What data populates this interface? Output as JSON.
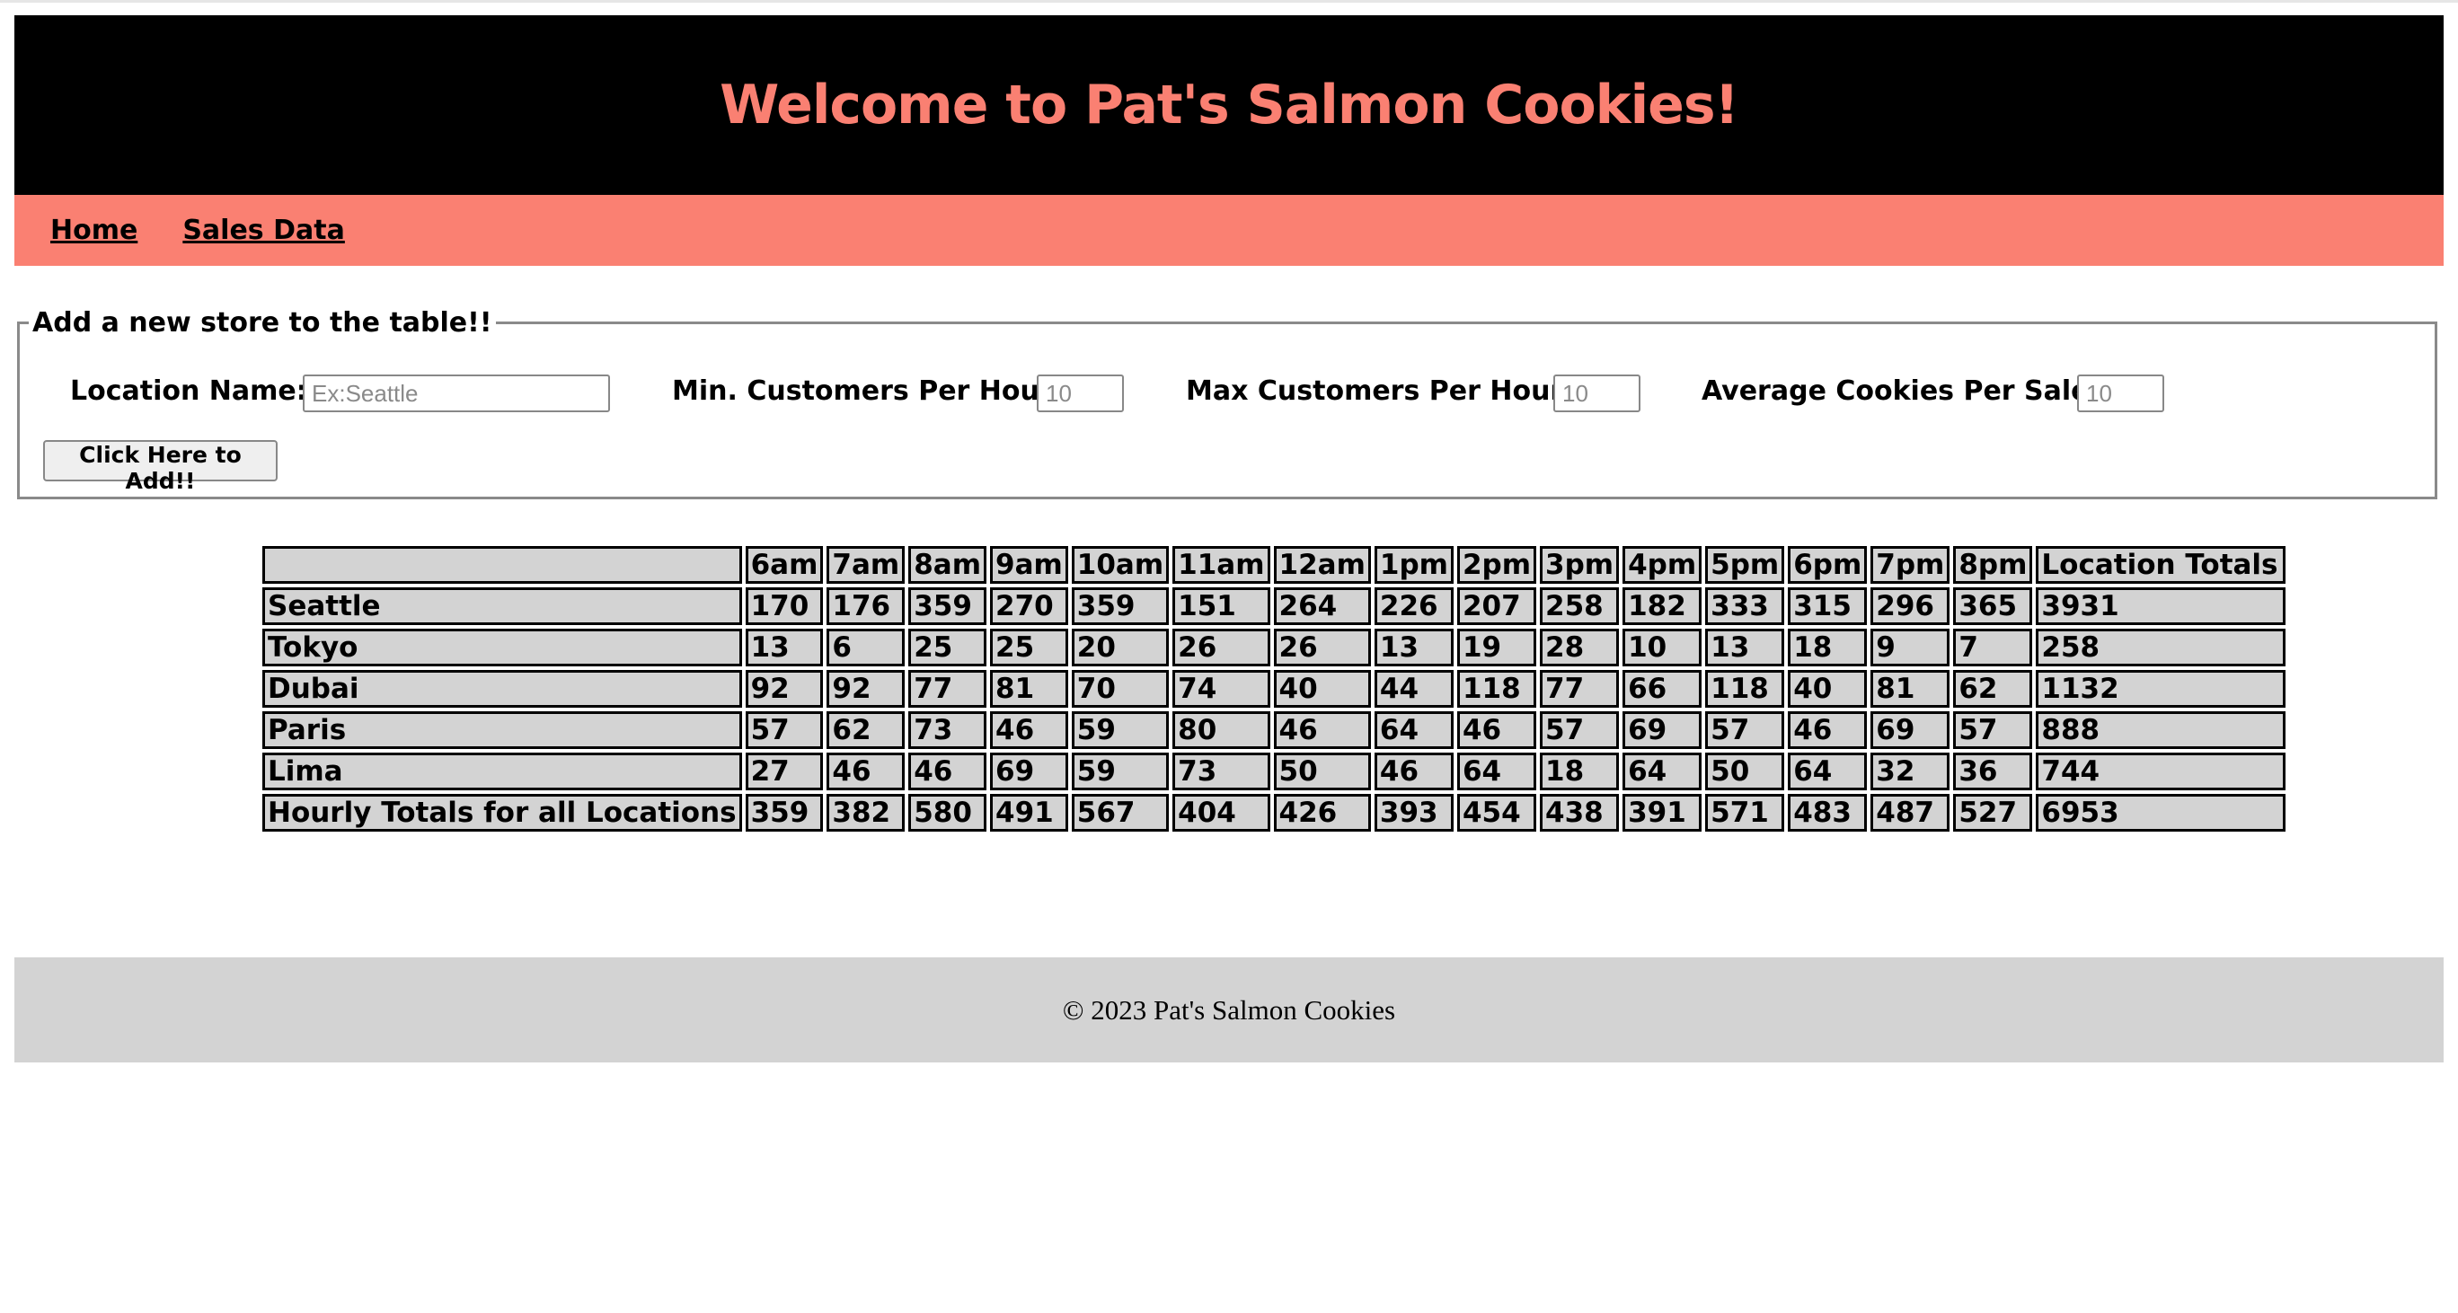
{
  "header": {
    "title": "Welcome to Pat's Salmon Cookies!"
  },
  "nav": {
    "home": "Home",
    "sales_data": "Sales Data"
  },
  "form": {
    "legend": "Add a new store to the table!!",
    "location_label": "Location Name:",
    "location_placeholder": "Ex:Seattle",
    "location_value": "",
    "min_label": "Min. Customers Per Hour:",
    "min_placeholder": "10",
    "max_label": "Max Customers Per Hour:",
    "max_placeholder": "10",
    "avg_label": "Average Cookies Per Sale:",
    "avg_placeholder": "10",
    "submit_label": "Click Here to Add!!"
  },
  "table": {
    "corner": "",
    "hours": [
      "6am",
      "7am",
      "8am",
      "9am",
      "10am",
      "11am",
      "12am",
      "1pm",
      "2pm",
      "3pm",
      "4pm",
      "5pm",
      "6pm",
      "7pm",
      "8pm"
    ],
    "total_header": "Location Totals",
    "rows": [
      {
        "name": "Seattle",
        "values": [
          "170",
          "176",
          "359",
          "270",
          "359",
          "151",
          "264",
          "226",
          "207",
          "258",
          "182",
          "333",
          "315",
          "296",
          "365"
        ],
        "total": "3931"
      },
      {
        "name": "Tokyo",
        "values": [
          "13",
          "6",
          "25",
          "25",
          "20",
          "26",
          "26",
          "13",
          "19",
          "28",
          "10",
          "13",
          "18",
          "9",
          "7"
        ],
        "total": "258"
      },
      {
        "name": "Dubai",
        "values": [
          "92",
          "92",
          "77",
          "81",
          "70",
          "74",
          "40",
          "44",
          "118",
          "77",
          "66",
          "118",
          "40",
          "81",
          "62"
        ],
        "total": "1132"
      },
      {
        "name": "Paris",
        "values": [
          "57",
          "62",
          "73",
          "46",
          "59",
          "80",
          "46",
          "64",
          "46",
          "57",
          "69",
          "57",
          "46",
          "69",
          "57"
        ],
        "total": "888"
      },
      {
        "name": "Lima",
        "values": [
          "27",
          "46",
          "46",
          "69",
          "59",
          "73",
          "50",
          "46",
          "64",
          "18",
          "64",
          "50",
          "64",
          "32",
          "36"
        ],
        "total": "744"
      }
    ],
    "footer_label": "Hourly Totals for all Locations",
    "footer_values": [
      "359",
      "382",
      "580",
      "491",
      "567",
      "404",
      "426",
      "393",
      "454",
      "438",
      "391",
      "571",
      "483",
      "487",
      "527"
    ],
    "footer_total": "6953"
  },
  "footer": {
    "copyright": "© 2023 Pat's Salmon Cookies"
  },
  "colors": {
    "accent": "#fa8072",
    "banner": "#000000",
    "cell": "#d3d3d3",
    "footer": "#d3d3d3"
  }
}
